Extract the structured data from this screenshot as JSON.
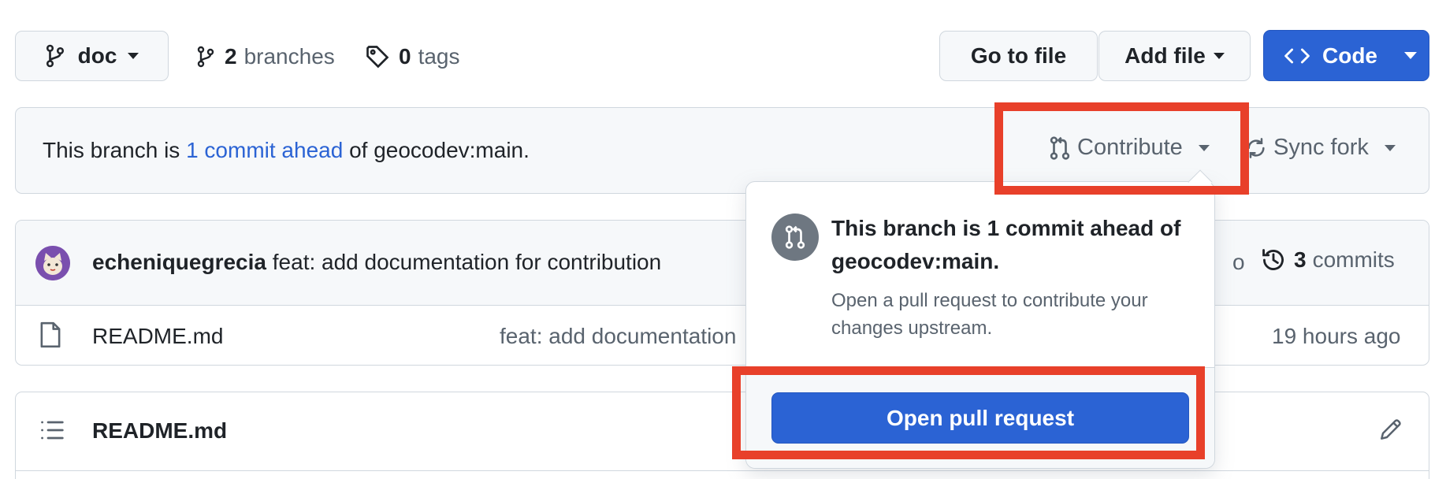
{
  "toolbar": {
    "branch_name": "doc",
    "branches_count": "2",
    "branches_label": "branches",
    "tags_count": "0",
    "tags_label": "tags",
    "go_to_file_label": "Go to file",
    "add_file_label": "Add file",
    "code_label": "Code"
  },
  "banner": {
    "prefix": "This branch is ",
    "link": "1 commit ahead",
    "suffix": " of geocodev:main.",
    "contribute_label": "Contribute",
    "sync_label": "Sync fork"
  },
  "latest_commit": {
    "author": "echeniquegrecia",
    "message": "feat: add documentation for contribution",
    "time_fragment": "o",
    "commits_count": "3",
    "commits_label": "commits"
  },
  "files": [
    {
      "name": "README.md",
      "message": "feat: add documentation",
      "time": "19 hours ago"
    }
  ],
  "readme": {
    "title": "README.md"
  },
  "popover": {
    "title": "This branch is 1 commit ahead of geocodev:main.",
    "description": "Open a pull request to contribute your changes upstream.",
    "button_label": "Open pull request"
  },
  "colors": {
    "accent": "#2b63d4",
    "highlight": "#e8402a",
    "muted": "#59636e",
    "border": "#d0d7de"
  }
}
